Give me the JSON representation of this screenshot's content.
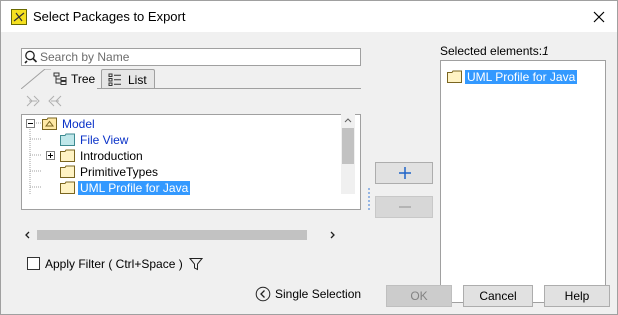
{
  "window": {
    "title": "Select Packages to Export"
  },
  "search": {
    "placeholder": "Search by Name",
    "value": ""
  },
  "tabs": [
    {
      "label": "Tree",
      "icon": "tree-icon",
      "active": true
    },
    {
      "label": "List",
      "icon": "list-icon",
      "active": false
    }
  ],
  "tree": {
    "rows": [
      {
        "label": "Model",
        "expanded": true,
        "color": "#0a32c8"
      },
      {
        "label": "File View",
        "color": "#0a32c8"
      },
      {
        "label": "Introduction",
        "collapsed": true
      },
      {
        "label": "PrimitiveTypes"
      },
      {
        "label": "UML Profile for Java",
        "selected": true
      }
    ]
  },
  "filter": {
    "apply_label": "Apply Filter ( Ctrl+Space )",
    "checked": false
  },
  "single_selection": {
    "label": "Single Selection"
  },
  "selected": {
    "label": "Selected elements:",
    "count": "1",
    "items": [
      "UML Profile for Java"
    ]
  },
  "buttons": {
    "ok": "OK",
    "cancel": "Cancel",
    "help": "Help"
  },
  "colors": {
    "selection": "#3399ff",
    "link_blue": "#0a32c8"
  }
}
